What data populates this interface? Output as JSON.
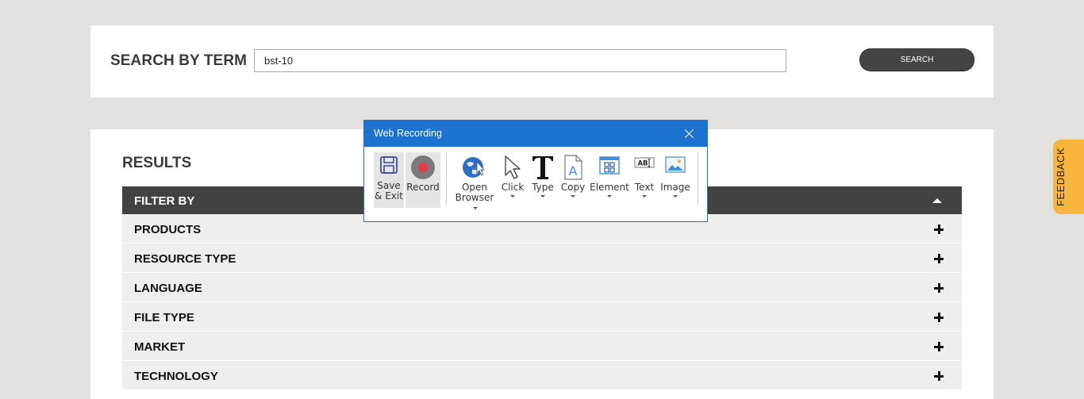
{
  "search": {
    "title": "SEARCH BY TERM",
    "value": "bst-10",
    "button_label": "SEARCH"
  },
  "results": {
    "title": "RESULTS",
    "filter_header": "FILTER BY",
    "filters": [
      {
        "label": "PRODUCTS"
      },
      {
        "label": "RESOURCE TYPE"
      },
      {
        "label": "LANGUAGE"
      },
      {
        "label": "FILE TYPE"
      },
      {
        "label": "MARKET"
      },
      {
        "label": "TECHNOLOGY"
      }
    ]
  },
  "feedback": {
    "label": "FEEDBACK"
  },
  "dialog": {
    "title": "Web Recording",
    "tools": [
      {
        "line1": "Save",
        "line2": "& Exit",
        "icon": "save-icon"
      },
      {
        "line1": "Record",
        "icon": "record-icon"
      },
      {
        "line1": "Open",
        "line2": "Browser",
        "icon": "globe-cursor-icon"
      },
      {
        "line1": "Click",
        "icon": "cursor-icon"
      },
      {
        "line1": "Type",
        "icon": "type-icon"
      },
      {
        "line1": "Copy",
        "icon": "copy-icon"
      },
      {
        "line1": "Element",
        "icon": "element-icon"
      },
      {
        "line1": "Text",
        "icon": "text-icon"
      },
      {
        "line1": "Image",
        "icon": "image-icon"
      }
    ]
  },
  "colors": {
    "page_bg": "#e2e1dd",
    "panel_bg": "#ffffff",
    "filter_header_bg": "#424242",
    "filter_item_bg": "#efeeeb",
    "dialog_titlebar": "#1e72cf",
    "feedback_tab": "#f7b53b"
  }
}
